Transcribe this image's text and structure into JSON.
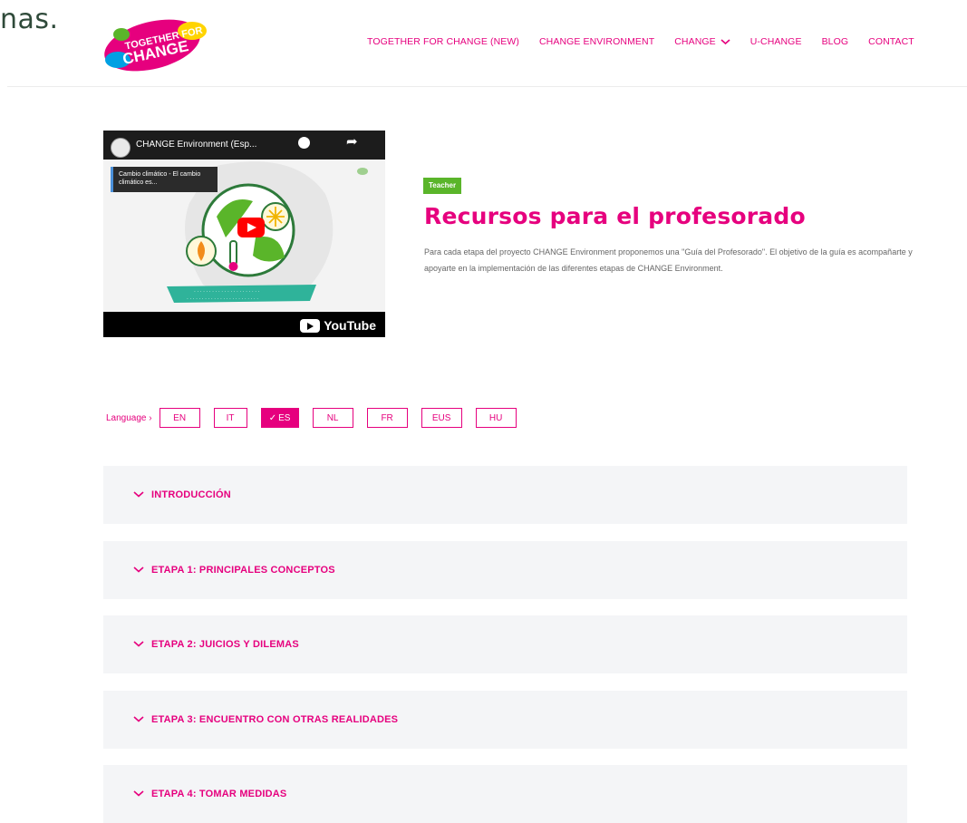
{
  "top_fragment": "nas.",
  "logo": {
    "text": "TOGETHER FOR CHANGE",
    "colors": [
      "#e6007e",
      "#ffd400",
      "#00a0e3",
      "#5ab52a"
    ]
  },
  "nav": {
    "items": [
      {
        "label": "TOGETHER FOR CHANGE (NEW)"
      },
      {
        "label": "CHANGE ENVIRONMENT"
      },
      {
        "label": "CHANGE",
        "has_dropdown": true
      },
      {
        "label": "U-CHANGE"
      },
      {
        "label": "BLOG"
      },
      {
        "label": "CONTACT"
      }
    ]
  },
  "video": {
    "title": "CHANGE Environment (Esp...",
    "card_text": "Cambio climático - El cambio climático es...",
    "youtube_label": "YouTube"
  },
  "tag": "Teacher",
  "page_title": "Recursos para el profesorado",
  "description": "Para cada etapa del proyecto CHANGE Environment proponemos una \"Guía del Profesorado\". El objetivo de la guía es acompañarte y apoyarte en la implementación de las diferentes etapas de CHANGE Environment.",
  "language": {
    "label": "Language ›",
    "options": [
      "EN",
      "IT",
      "ES",
      "NL",
      "FR",
      "EUS",
      "HU"
    ],
    "selected": "ES"
  },
  "accordion": [
    "INTRODUCCIÓN",
    "ETAPA 1: PRINCIPALES CONCEPTOS",
    "ETAPA 2: JUICIOS Y DILEMAS",
    "ETAPA 3: ENCUENTRO CON OTRAS REALIDADES",
    "ETAPA 4: TOMAR MEDIDAS"
  ],
  "colors": {
    "accent": "#e6007e",
    "tag": "#5ab52a",
    "panel": "#f4f5f7"
  }
}
